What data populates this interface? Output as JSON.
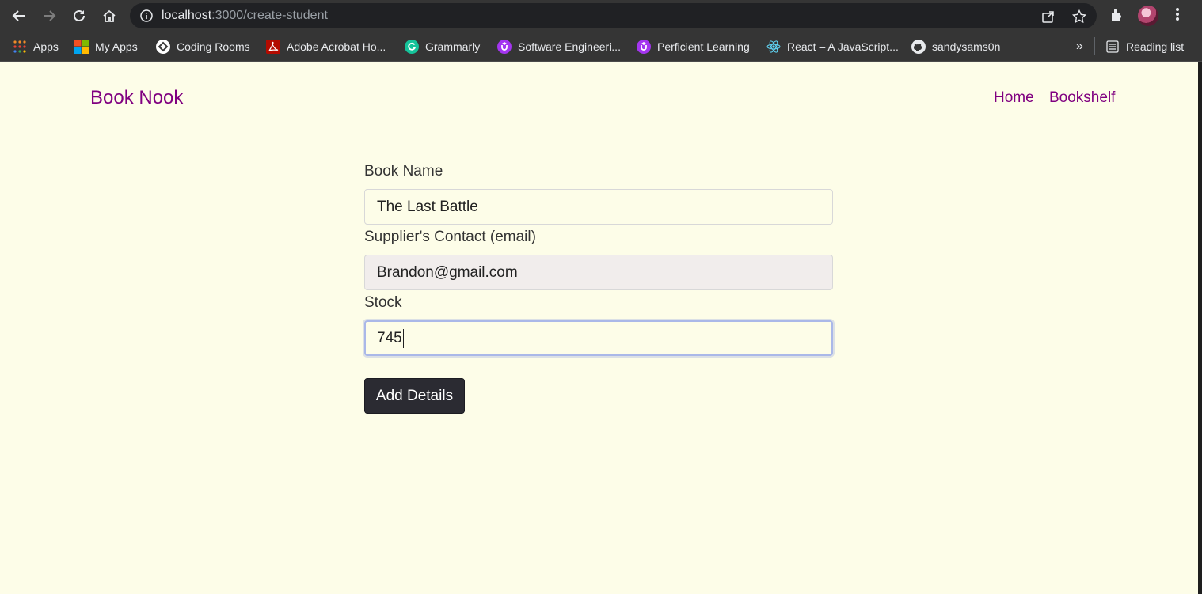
{
  "browser": {
    "url_host": "localhost",
    "url_path": ":3000/create-student",
    "bookmarks": [
      {
        "label": "Apps",
        "icon": "apps-grid-icon"
      },
      {
        "label": "My Apps",
        "icon": "microsoft-icon"
      },
      {
        "label": "Coding Rooms",
        "icon": "coding-rooms-icon"
      },
      {
        "label": "Adobe Acrobat Ho...",
        "icon": "acrobat-icon"
      },
      {
        "label": "Grammarly",
        "icon": "grammarly-icon"
      },
      {
        "label": "Software Engineeri...",
        "icon": "udemy-icon"
      },
      {
        "label": "Perficient Learning",
        "icon": "udemy-icon"
      },
      {
        "label": "React – A JavaScript...",
        "icon": "react-icon"
      },
      {
        "label": "sandysams0n",
        "icon": "github-icon"
      }
    ],
    "overflow_label": "»",
    "reading_list_label": "Reading list"
  },
  "header": {
    "brand": "Book Nook",
    "nav": [
      "Home",
      "Bookshelf"
    ]
  },
  "form": {
    "book_name_label": "Book Name",
    "book_name_value": "The Last Battle",
    "email_label": "Supplier's Contact (email)",
    "email_value": "Brandon@gmail.com",
    "stock_label": "Stock",
    "stock_value": "745",
    "submit_label": "Add Details"
  },
  "colors": {
    "page_bg": "#fdfde8",
    "brand": "#800080",
    "button_bg": "#2b2b32",
    "chrome_bg": "#353535"
  }
}
